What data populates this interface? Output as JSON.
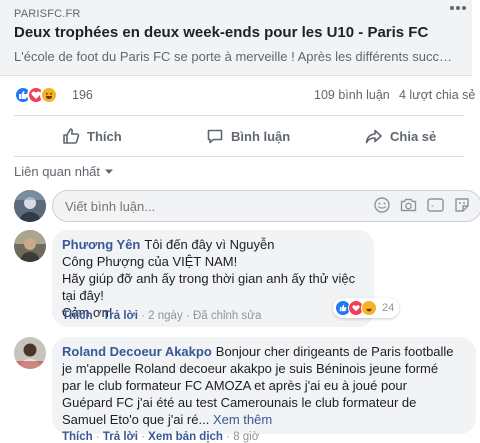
{
  "link_card": {
    "domain": "PARISFC.FR",
    "title": "Deux trophées en deux week-ends pour les U10 - Paris FC",
    "description": "L'école de foot du Paris FC se porte à merveille ! Après les différents succ…"
  },
  "reactions": {
    "icons": [
      "like-icon",
      "love-icon",
      "haha-icon"
    ],
    "count": "196",
    "comments": "109 bình luận",
    "shares": "4 lượt chia sẻ"
  },
  "actions": {
    "like": "Thích",
    "comment": "Bình luận",
    "share": "Chia sẻ"
  },
  "sort": {
    "label": "Liên quan nhất"
  },
  "composer": {
    "placeholder": "Viết bình luận...",
    "icons": [
      "emoji-icon",
      "camera-icon",
      "gif-icon",
      "sticker-icon"
    ]
  },
  "comments": [
    {
      "author": "Phương Yên",
      "lines": [
        "Tôi đến đây vì Nguyễn",
        "Công Phượng của VIỆT NAM!",
        "Hãy giúp đỡ anh ấy trong thời gian anh ấy thử việc tại đây!",
        "Cảm ơn!"
      ],
      "reactions_count": "24",
      "actions": {
        "like": "Thích",
        "reply": "Trả lời",
        "time": "2 ngày",
        "edited": "Đã chỉnh sửa"
      }
    },
    {
      "author": "Roland Decoeur Akakpo",
      "lines": [
        "Bonjour cher dirigeants de Paris footballe",
        "je m'appelle Roland decoeur akakpo je suis Béninois jeune formé",
        "par le club formateur FC AMOZA et après j'ai eu à joué pour",
        "Guépard FC j'ai été au test Camerounais le club formateur de",
        "Samuel Eto'o que j'ai ré..."
      ],
      "see_more": "Xem thêm",
      "actions": {
        "like": "Thích",
        "reply": "Trả lời",
        "translate": "Xem bản dịch",
        "time": "8 giờ"
      }
    }
  ],
  "colors": {
    "link": "#385898",
    "like": "#2078f4",
    "love": "#f33e58",
    "haha": "#f7b125",
    "muted": "#606770"
  }
}
